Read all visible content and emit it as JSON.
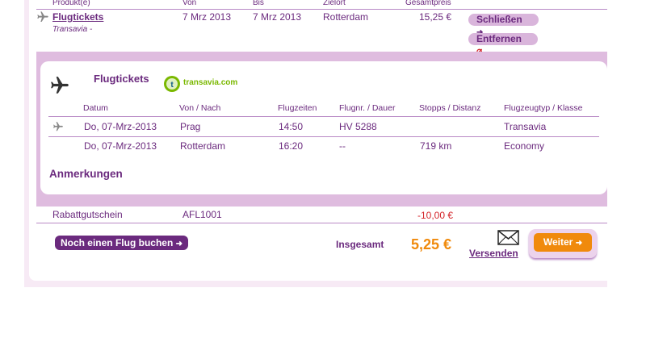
{
  "header": {
    "cols": [
      "Produkt(e)",
      "Von",
      "Bis",
      "Zielort",
      "Gesamtpreis"
    ]
  },
  "product_row": {
    "name": "Flugtickets",
    "carrier": "Transavia -",
    "von": "7 Mrz 2013",
    "bis": "7 Mrz 2013",
    "zielort": "Rotterdam",
    "price": "15,25 €",
    "close_label": "Schließen",
    "remove_label": "Entfernen"
  },
  "detail": {
    "title": "Flugtickets",
    "logo_text": "transavia.com",
    "columns": [
      "Datum",
      "Von / Nach",
      "Flugzeiten",
      "Flugnr. / Dauer",
      "Stopps / Distanz",
      "Flugzeugtyp / Klasse"
    ],
    "rows": [
      [
        "Do, 07-Mrz-2013",
        "Prag",
        "14:50",
        "HV 5288",
        "",
        "Transavia"
      ],
      [
        "Do, 07-Mrz-2013",
        "Rotterdam",
        "16:20",
        "--",
        "719 km",
        "Economy"
      ]
    ],
    "remarks_label": "Anmerkungen"
  },
  "voucher": {
    "label": "Rabattgutschein",
    "code": "AFL1001",
    "amount": "-10,00 €"
  },
  "footer": {
    "book_more_label": "Noch einen Flug buchen",
    "total_label": "Insgesamt",
    "total_value": "5,25 €",
    "send_label": "Versenden",
    "next_label": "Weiter"
  },
  "colors": {
    "purple": "#6b2a7e",
    "light_purple": "#dfbcdf",
    "orange": "#f08a0c",
    "red": "#d4242a",
    "logo_green": "#7ab800"
  }
}
